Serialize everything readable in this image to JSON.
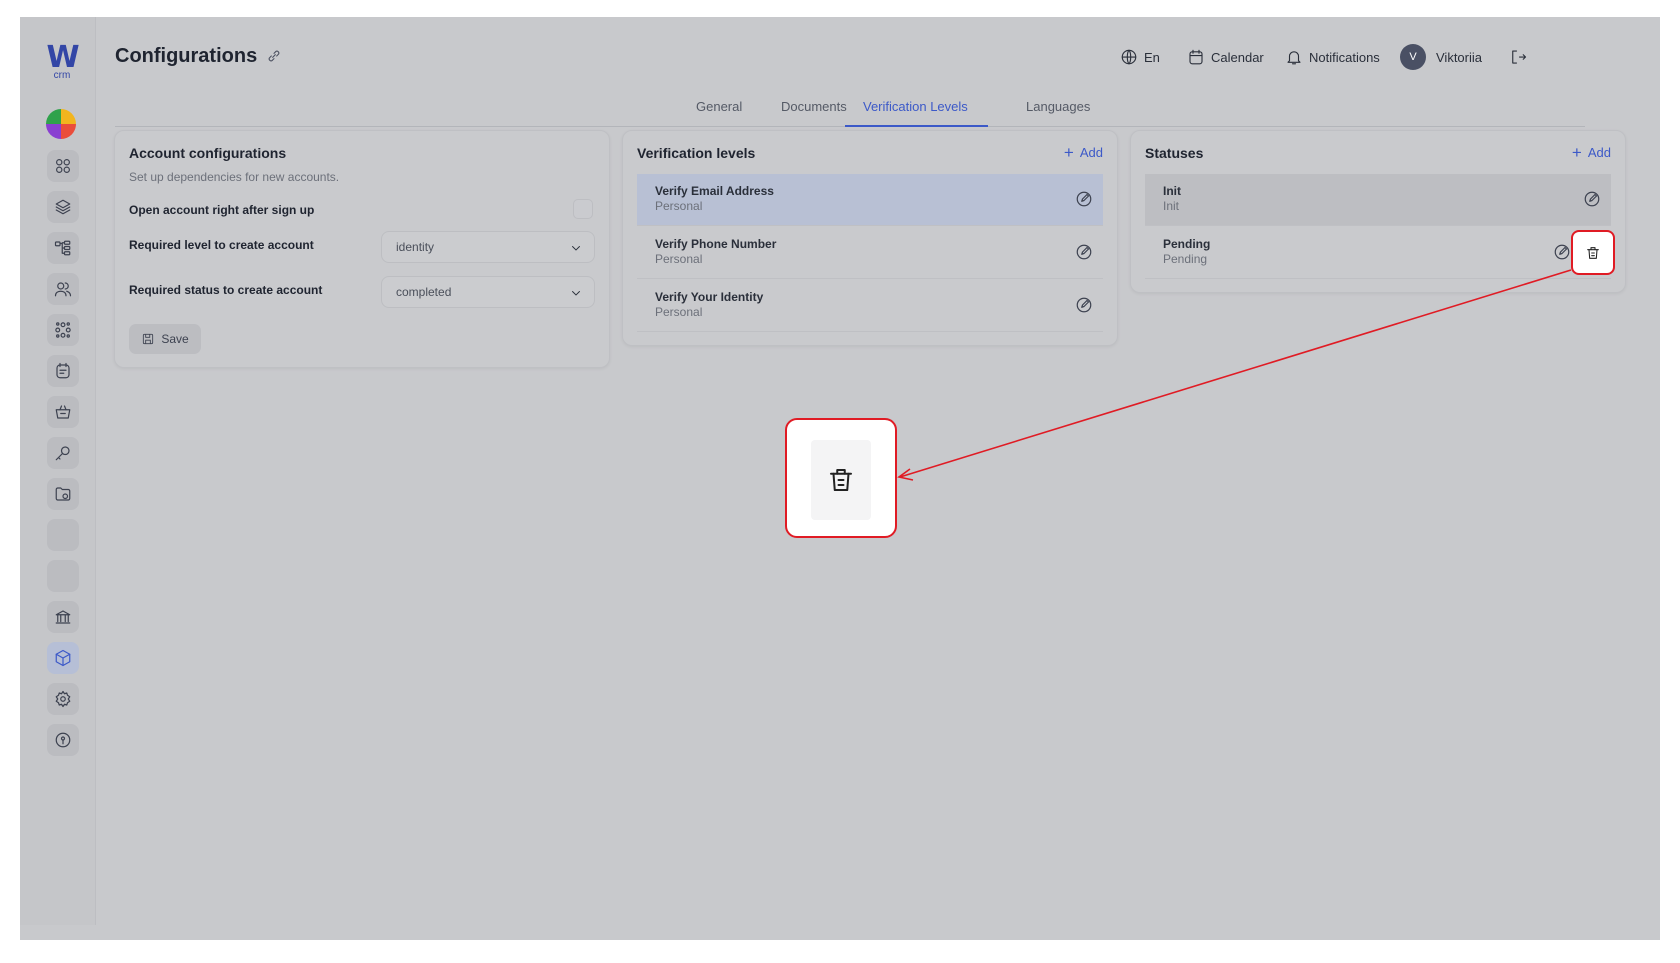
{
  "app": {
    "logo_letter": "W",
    "logo_sub": "crm",
    "page_title": "Configurations"
  },
  "topbar": {
    "language": "En",
    "calendar": "Calendar",
    "notifications": "Notifications",
    "avatar_initial": "V",
    "user_name": "Viktoriia"
  },
  "tabs": [
    "General",
    "Documents",
    "Verification Levels",
    "Languages"
  ],
  "active_tab": "Verification Levels",
  "sidebar": {
    "icons": [
      "dashboard-icon",
      "layers-icon",
      "hierarchy-icon",
      "users-icon",
      "network-icon",
      "notes-icon",
      "basket-icon",
      "key-icon",
      "folder-icon",
      "blank-icon",
      "blank-icon",
      "bank-icon",
      "cube-icon",
      "gear-icon",
      "shield-icon"
    ],
    "active_index": 12
  },
  "account_config": {
    "title": "Account configurations",
    "subtitle": "Set up dependencies for new accounts.",
    "open_account_label": "Open account right  after sign up",
    "open_account_checked": false,
    "level_label": "Required level to create account",
    "level_value": "identity",
    "status_label": "Required status to create account",
    "status_value": "completed",
    "save_label": "Save"
  },
  "verification_levels": {
    "title": "Verification levels",
    "add_label": "Add",
    "items": [
      {
        "name": "Verify Email Address",
        "type": "Personal"
      },
      {
        "name": "Verify Phone Number",
        "type": "Personal"
      },
      {
        "name": "Verify Your Identity",
        "type": "Personal"
      }
    ]
  },
  "statuses": {
    "title": "Statuses",
    "add_label": "Add",
    "items": [
      {
        "name": "Init",
        "type": "Init"
      },
      {
        "name": "Pending",
        "type": "Pending"
      }
    ]
  },
  "colors": {
    "accent": "#3c59c8",
    "highlight": "#e01b24",
    "overlay": "#c8c9cc"
  }
}
